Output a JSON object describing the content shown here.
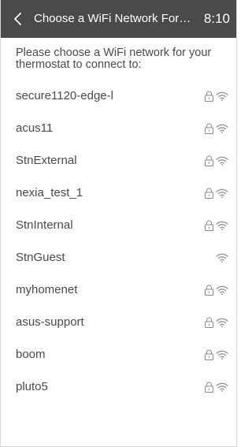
{
  "header": {
    "title": "Choose a WiFi Network For Your Thermostat",
    "time": "8:10"
  },
  "prompt": "Please choose a WiFi network for your thermostat to connect to:",
  "networks": [
    {
      "name": "secure1120-edge-l",
      "secured": true
    },
    {
      "name": "acus11",
      "secured": true
    },
    {
      "name": "StnExternal",
      "secured": true
    },
    {
      "name": "nexia_test_1",
      "secured": true
    },
    {
      "name": "StnInternal",
      "secured": true
    },
    {
      "name": "StnGuest",
      "secured": false
    },
    {
      "name": "myhomenet",
      "secured": true
    },
    {
      "name": "asus-support",
      "secured": true
    },
    {
      "name": "boom",
      "secured": true
    },
    {
      "name": "pluto5",
      "secured": true
    }
  ],
  "icons": {
    "back": "chevron-left-icon",
    "lock": "lock-icon",
    "wifi": "wifi-icon"
  },
  "colors": {
    "header_bg": "#4a4a4a",
    "text": "#4a4a4a",
    "icon": "#8a8a8a"
  }
}
